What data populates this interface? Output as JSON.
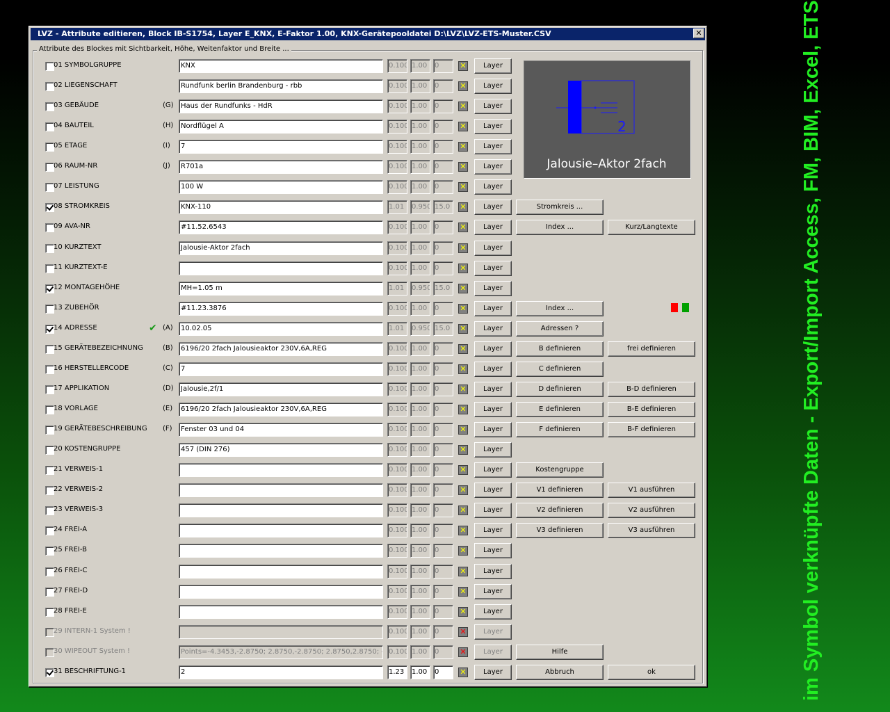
{
  "side_caption": "im Symbol verknüpfte Daten - Export/Import Access, FM, BIM, Excel, ETS",
  "dialog": {
    "title": "LVZ - Attribute editieren, Block IB-S1754, Layer E_KNX, E-Faktor 1.00, KNX-Gerätepooldatei D:\\LVZ\\LVZ-ETS-Muster.CSV",
    "close": "✕",
    "group_label": "Attribute des Blockes mit Sichtbarkeit, Höhe, Weitenfaktor und Breite ..."
  },
  "preview": {
    "label": "Jalousie–Aktor 2fach",
    "number": "2"
  },
  "status_colors": {
    "red": "#ff0000",
    "green": "#00a000"
  },
  "rows": [
    {
      "name": "01  SYMBOLGRUPPE",
      "letter": "",
      "value": "KNX",
      "n1": "0.100",
      "n2": "1.00",
      "n3": "0",
      "checked": false,
      "x": "✕",
      "layer": "Layer",
      "b2": "",
      "b3": ""
    },
    {
      "name": "02  LIEGENSCHAFT",
      "letter": "",
      "value": "Rundfunk berlin Brandenburg - rbb",
      "n1": "0.100",
      "n2": "1.00",
      "n3": "0",
      "checked": false,
      "x": "✕",
      "layer": "Layer",
      "b2": "",
      "b3": ""
    },
    {
      "name": "03  GEBÄUDE",
      "letter": "(G)",
      "value": "Haus der Rundfunks - HdR",
      "n1": "0.100",
      "n2": "1.00",
      "n3": "0",
      "checked": false,
      "x": "✕",
      "layer": "Layer",
      "b2": "",
      "b3": ""
    },
    {
      "name": "04  BAUTEIL",
      "letter": "(H)",
      "value": "Nordflügel A",
      "n1": "0.100",
      "n2": "1.00",
      "n3": "0",
      "checked": false,
      "x": "✕",
      "layer": "Layer",
      "b2": "",
      "b3": ""
    },
    {
      "name": "05  ETAGE",
      "letter": "(I)",
      "value": "7",
      "n1": "0.100",
      "n2": "1.00",
      "n3": "0",
      "checked": false,
      "x": "✕",
      "layer": "Layer",
      "b2": "",
      "b3": ""
    },
    {
      "name": "06  RAUM-NR",
      "letter": "(J)",
      "value": "R701a",
      "n1": "0.100",
      "n2": "1.00",
      "n3": "0",
      "checked": false,
      "x": "✕",
      "layer": "Layer",
      "b2": "",
      "b3": ""
    },
    {
      "name": "07  LEISTUNG",
      "letter": "",
      "value": "100 W",
      "n1": "0.100",
      "n2": "1.00",
      "n3": "0",
      "checked": false,
      "x": "✕",
      "layer": "Layer",
      "b2": "",
      "b3": ""
    },
    {
      "name": "08  STROMKREIS",
      "letter": "",
      "value": "KNX-110",
      "n1": "1.01",
      "n2": "0.950",
      "n3": "15.0",
      "checked": true,
      "x": "✕",
      "layer": "Layer",
      "b2": "Stromkreis ...",
      "b3": ""
    },
    {
      "name": "09  AVA-NR",
      "letter": "",
      "value": "#11.52.6543",
      "n1": "0.100",
      "n2": "1.00",
      "n3": "0",
      "checked": false,
      "x": "✕",
      "layer": "Layer",
      "b2": "Index ...",
      "b3": "Kurz/Langtexte"
    },
    {
      "name": "10  KURZTEXT",
      "letter": "",
      "value": "Jalousie-Aktor 2fach",
      "n1": "0.100",
      "n2": "1.00",
      "n3": "0",
      "checked": false,
      "x": "✕",
      "layer": "Layer",
      "b2": "",
      "b3": ""
    },
    {
      "name": "11  KURZTEXT-E",
      "letter": "",
      "value": "",
      "n1": "0.100",
      "n2": "1.00",
      "n3": "0",
      "checked": false,
      "x": "✕",
      "layer": "Layer",
      "b2": "",
      "b3": ""
    },
    {
      "name": "12  MONTAGEHÖHE",
      "letter": "",
      "value": "MH=1.05 m",
      "n1": "1.01",
      "n2": "0.950",
      "n3": "15.0",
      "checked": true,
      "x": "✕",
      "layer": "Layer",
      "b2": "",
      "b3": ""
    },
    {
      "name": "13  ZUBEHÖR",
      "letter": "",
      "value": "#11.23.3876",
      "n1": "0.100",
      "n2": "1.00",
      "n3": "0",
      "checked": false,
      "x": "✕",
      "layer": "Layer",
      "b2": "Index ...",
      "b3": ""
    },
    {
      "name": "14  ADRESSE",
      "letter": "(A)",
      "value": "10.02.05",
      "n1": "1.01",
      "n2": "0.950",
      "n3": "15.0",
      "checked": true,
      "x": "✕",
      "layer": "Layer",
      "b2": "Adressen ?",
      "b3": "",
      "mark": "✔"
    },
    {
      "name": "15  GERÄTEBEZEICHNUNG",
      "letter": "(B)",
      "value": "6196/20 2fach Jalousieaktor 230V,6A,REG",
      "n1": "0.100",
      "n2": "1.00",
      "n3": "0",
      "checked": false,
      "x": "✕",
      "layer": "Layer",
      "b2": "B definieren",
      "b3": "frei definieren"
    },
    {
      "name": "16  HERSTELLERCODE",
      "letter": "(C)",
      "value": "7",
      "n1": "0.100",
      "n2": "1.00",
      "n3": "0",
      "checked": false,
      "x": "✕",
      "layer": "Layer",
      "b2": "C definieren",
      "b3": ""
    },
    {
      "name": "17  APPLIKATION",
      "letter": "(D)",
      "value": "Jalousie,2f/1",
      "n1": "0.100",
      "n2": "1.00",
      "n3": "0",
      "checked": false,
      "x": "✕",
      "layer": "Layer",
      "b2": "D definieren",
      "b3": "B-D definieren"
    },
    {
      "name": "18  VORLAGE",
      "letter": "(E)",
      "value": "6196/20 2fach Jalousieaktor 230V,6A,REG",
      "n1": "0.100",
      "n2": "1.00",
      "n3": "0",
      "checked": false,
      "x": "✕",
      "layer": "Layer",
      "b2": "E definieren",
      "b3": "B-E definieren"
    },
    {
      "name": "19  GERÄTEBESCHREIBUNG",
      "letter": "(F)",
      "value": "Fenster 03 und 04",
      "n1": "0.100",
      "n2": "1.00",
      "n3": "0",
      "checked": false,
      "x": "✕",
      "layer": "Layer",
      "b2": "F definieren",
      "b3": "B-F definieren"
    },
    {
      "name": "20  KOSTENGRUPPE",
      "letter": "",
      "value": "457 (DIN 276)",
      "n1": "0.100",
      "n2": "1.00",
      "n3": "0",
      "checked": false,
      "x": "✕",
      "layer": "Layer",
      "b2": "",
      "b3": ""
    },
    {
      "name": "21  VERWEIS-1",
      "letter": "",
      "value": "",
      "n1": "0.100",
      "n2": "1.00",
      "n3": "0",
      "checked": false,
      "x": "✕",
      "layer": "Layer",
      "b2": "Kostengruppe",
      "b3": ""
    },
    {
      "name": "22  VERWEIS-2",
      "letter": "",
      "value": "",
      "n1": "0.100",
      "n2": "1.00",
      "n3": "0",
      "checked": false,
      "x": "✕",
      "layer": "Layer",
      "b2": "V1 definieren",
      "b3": "V1 ausführen"
    },
    {
      "name": "23  VERWEIS-3",
      "letter": "",
      "value": "",
      "n1": "0.100",
      "n2": "1.00",
      "n3": "0",
      "checked": false,
      "x": "✕",
      "layer": "Layer",
      "b2": "V2 definieren",
      "b3": "V2 ausführen"
    },
    {
      "name": "24  FREI-A",
      "letter": "",
      "value": "",
      "n1": "0.100",
      "n2": "1.00",
      "n3": "0",
      "checked": false,
      "x": "✕",
      "layer": "Layer",
      "b2": "V3 definieren",
      "b3": "V3 ausführen"
    },
    {
      "name": "25  FREI-B",
      "letter": "",
      "value": "",
      "n1": "0.100",
      "n2": "1.00",
      "n3": "0",
      "checked": false,
      "x": "✕",
      "layer": "Layer",
      "b2": "",
      "b3": ""
    },
    {
      "name": "26  FREI-C",
      "letter": "",
      "value": "",
      "n1": "0.100",
      "n2": "1.00",
      "n3": "0",
      "checked": false,
      "x": "✕",
      "layer": "Layer",
      "b2": "",
      "b3": ""
    },
    {
      "name": "27  FREI-D",
      "letter": "",
      "value": "",
      "n1": "0.100",
      "n2": "1.00",
      "n3": "0",
      "checked": false,
      "x": "✕",
      "layer": "Layer",
      "b2": "",
      "b3": ""
    },
    {
      "name": "28  FREI-E",
      "letter": "",
      "value": "",
      "n1": "0.100",
      "n2": "1.00",
      "n3": "0",
      "checked": false,
      "x": "✕",
      "layer": "Layer",
      "b2": "",
      "b3": ""
    },
    {
      "name": "29  INTERN-1 System !",
      "letter": "",
      "value": "",
      "n1": "0.100",
      "n2": "1.00",
      "n3": "0",
      "checked": false,
      "disabled": true,
      "x": "✕",
      "layer": "Layer",
      "b2": "",
      "b3": ""
    },
    {
      "name": "30  WIPEOUT System !",
      "letter": "",
      "value": "Points=-4.3453,-2.8750; 2.8750,-2.8750; 2.8750,2.8750; -",
      "n1": "0.100",
      "n2": "1.00",
      "n3": "0",
      "checked": false,
      "disabled": true,
      "x": "✕",
      "layer": "Layer",
      "b2": "Hilfe",
      "b3": ""
    },
    {
      "name": "31  BESCHRIFTUNG-1",
      "letter": "",
      "value": "2",
      "n1": "1.23",
      "n2": "1.00",
      "n3": "0",
      "checked": true,
      "active": true,
      "x": "✕",
      "layer": "Layer",
      "b2": "Abbruch",
      "b3": "ok"
    }
  ]
}
